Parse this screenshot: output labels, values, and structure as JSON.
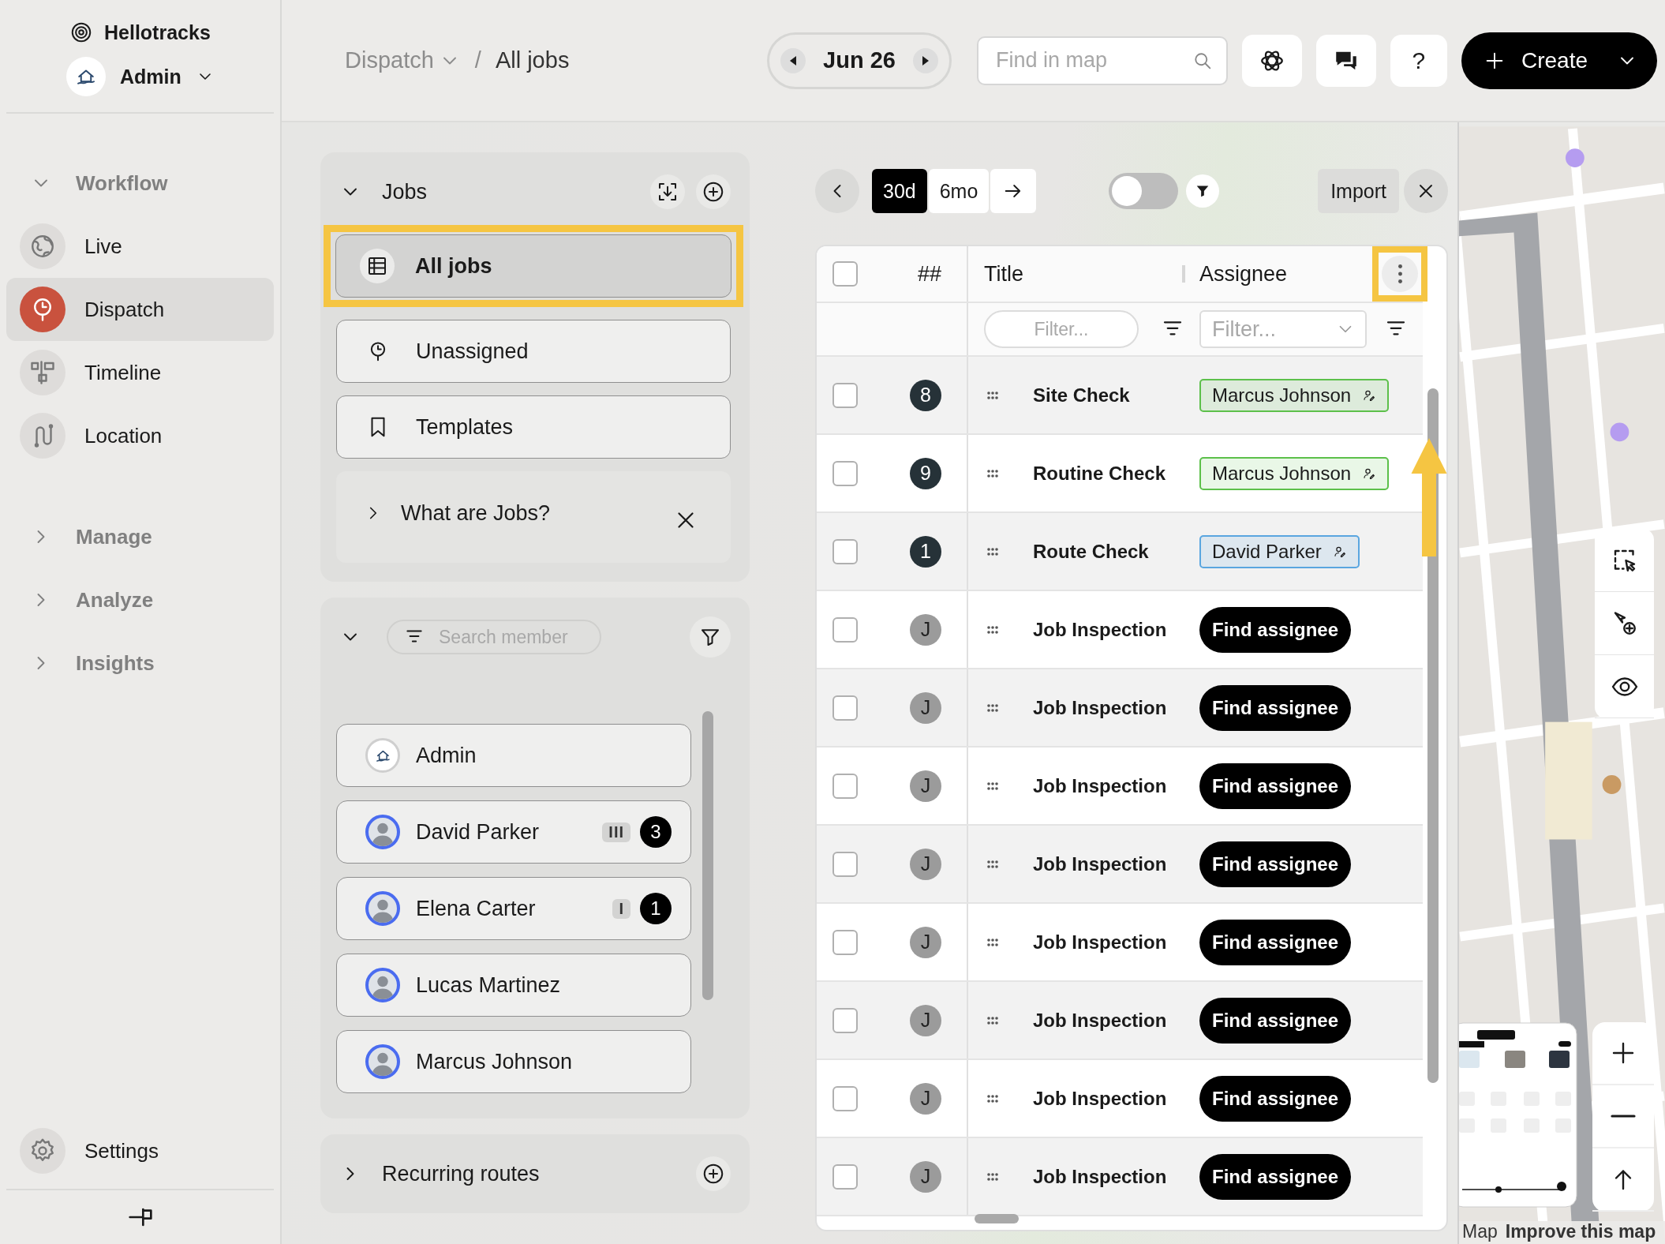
{
  "app": {
    "name": "Hellotracks",
    "account": "Admin"
  },
  "sidebar": {
    "sections": [
      {
        "label": "Workflow",
        "expanded": true,
        "items": [
          {
            "label": "Live",
            "selected": false
          },
          {
            "label": "Dispatch",
            "selected": true
          },
          {
            "label": "Timeline",
            "selected": false
          },
          {
            "label": "Location",
            "selected": false
          }
        ]
      },
      {
        "label": "Manage",
        "expanded": false
      },
      {
        "label": "Analyze",
        "expanded": false
      },
      {
        "label": "Insights",
        "expanded": false
      }
    ],
    "settings": "Settings"
  },
  "breadcrumb": {
    "separator": "/",
    "items": [
      {
        "label": "Dispatch",
        "dropdown": true
      },
      {
        "label": "All jobs",
        "dropdown": false
      }
    ]
  },
  "date": "Jun 26",
  "search": {
    "placeholder": "Find in map"
  },
  "help": "?",
  "create": "Create",
  "jobs_panel": {
    "title": "Jobs",
    "expanded": true,
    "views": [
      {
        "label": "All jobs",
        "selected": true,
        "highlighted": true
      },
      {
        "label": "Unassigned",
        "selected": false,
        "highlighted": false
      },
      {
        "label": "Templates",
        "selected": false,
        "highlighted": false
      }
    ],
    "info": {
      "label": "What are Jobs?",
      "expanded": false
    }
  },
  "members_panel": {
    "expanded": true,
    "search": {
      "placeholder": "Search member"
    },
    "members": [
      {
        "name": "Admin",
        "kind": "company"
      },
      {
        "name": "David Parker",
        "kind": "person",
        "tally": "III",
        "count": "3"
      },
      {
        "name": "Elena Carter",
        "kind": "person",
        "tally": "I",
        "count": "1"
      },
      {
        "name": "Lucas Martinez",
        "kind": "person"
      },
      {
        "name": "Marcus Johnson",
        "kind": "person"
      }
    ]
  },
  "routes_panel": {
    "title": "Recurring routes",
    "expanded": false
  },
  "toolbar": {
    "ranges": [
      {
        "label": "30d",
        "selected": true
      },
      {
        "label": "6mo",
        "selected": false
      }
    ],
    "toggle": {
      "on": false
    },
    "import": "Import"
  },
  "table": {
    "menu_highlighted": true,
    "pointer_arrow": true,
    "all_checked": false,
    "columns": [
      {
        "label": "##"
      },
      {
        "label": "Title",
        "filter": {
          "kind": "text",
          "placeholder": "Filter..."
        }
      },
      {
        "label": "Assignee",
        "filter": {
          "kind": "dropdown",
          "placeholder": "Filter..."
        }
      }
    ],
    "rows": [
      {
        "checked": false,
        "badge": {
          "kind": "number",
          "text": "8"
        },
        "title": "Site Check",
        "assignee": {
          "kind": "chip",
          "name": "Marcus Johnson",
          "color": "#5cc04a"
        }
      },
      {
        "checked": false,
        "badge": {
          "kind": "number",
          "text": "9"
        },
        "title": "Routine Check",
        "assignee": {
          "kind": "chip",
          "name": "Marcus Johnson",
          "color": "#5cc04a"
        }
      },
      {
        "checked": false,
        "badge": {
          "kind": "number",
          "text": "1"
        },
        "title": "Route Check",
        "assignee": {
          "kind": "chip",
          "name": "David Parker",
          "color": "#5aa6e0"
        }
      },
      {
        "checked": false,
        "badge": {
          "kind": "letter",
          "text": "J"
        },
        "title": "Job Inspection",
        "assignee": {
          "kind": "button",
          "name": "Find assignee"
        }
      },
      {
        "checked": false,
        "badge": {
          "kind": "letter",
          "text": "J"
        },
        "title": "Job Inspection",
        "assignee": {
          "kind": "button",
          "name": "Find assignee"
        }
      },
      {
        "checked": false,
        "badge": {
          "kind": "letter",
          "text": "J"
        },
        "title": "Job Inspection",
        "assignee": {
          "kind": "button",
          "name": "Find assignee"
        }
      },
      {
        "checked": false,
        "badge": {
          "kind": "letter",
          "text": "J"
        },
        "title": "Job Inspection",
        "assignee": {
          "kind": "button",
          "name": "Find assignee"
        }
      },
      {
        "checked": false,
        "badge": {
          "kind": "letter",
          "text": "J"
        },
        "title": "Job Inspection",
        "assignee": {
          "kind": "button",
          "name": "Find assignee"
        }
      },
      {
        "checked": false,
        "badge": {
          "kind": "letter",
          "text": "J"
        },
        "title": "Job Inspection",
        "assignee": {
          "kind": "button",
          "name": "Find assignee"
        }
      },
      {
        "checked": false,
        "badge": {
          "kind": "letter",
          "text": "J"
        },
        "title": "Job Inspection",
        "assignee": {
          "kind": "button",
          "name": "Find assignee"
        }
      },
      {
        "checked": false,
        "badge": {
          "kind": "letter",
          "text": "J"
        },
        "title": "Job Inspection",
        "assignee": {
          "kind": "button",
          "name": "Find assignee"
        }
      }
    ]
  },
  "map": {
    "kind": "picture",
    "attribution": [
      "Map",
      "Improve this map"
    ]
  }
}
